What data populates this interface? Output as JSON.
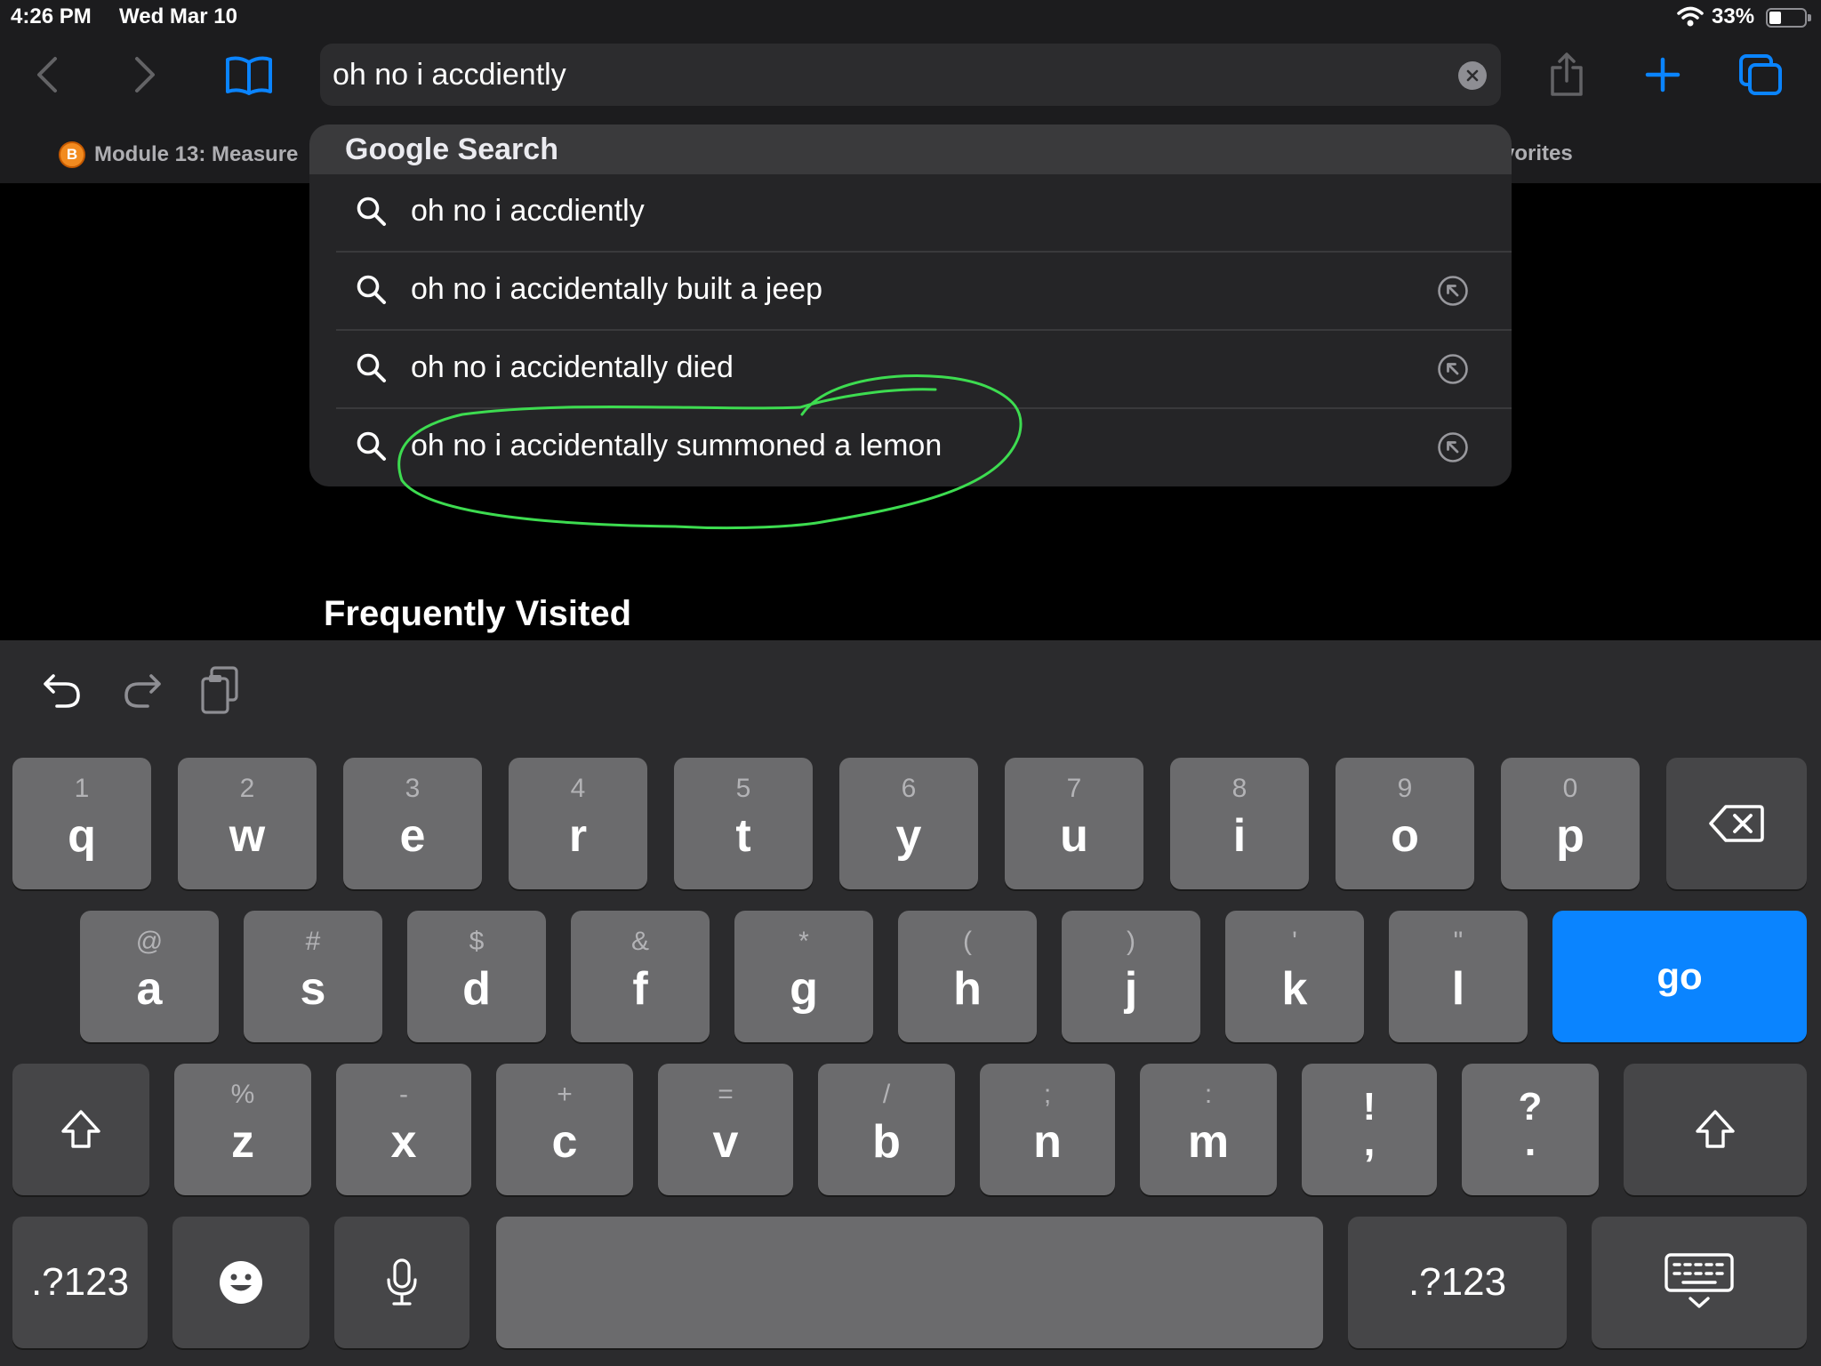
{
  "status_bar": {
    "time": "4:26 PM",
    "date": "Wed Mar 10",
    "battery_percent": "33%",
    "battery_level": 0.33
  },
  "toolbar": {
    "url_text": "oh no i accdiently"
  },
  "favorites_bar": {
    "item": "Module 13: Measure",
    "item_icon_letter": "B",
    "right_text": "vorites"
  },
  "suggestions": {
    "header": "Google Search",
    "items": [
      {
        "text": "oh no i accdiently",
        "has_fill": false
      },
      {
        "text": "oh no i accidentally built a jeep",
        "has_fill": true
      },
      {
        "text": "oh no i accidentally died",
        "has_fill": true
      },
      {
        "text": "oh no i accidentally summoned a lemon",
        "has_fill": true
      }
    ]
  },
  "content": {
    "frequently_visited": "Frequently Visited"
  },
  "colors": {
    "accent": "#0a84ff",
    "annotation": "#3ddc50",
    "keyboard_bg": "#2b2b2d",
    "key_bg": "#6b6b6d"
  },
  "keyboard": {
    "row1": [
      {
        "pri": "q",
        "sec": "1"
      },
      {
        "pri": "w",
        "sec": "2"
      },
      {
        "pri": "e",
        "sec": "3"
      },
      {
        "pri": "r",
        "sec": "4"
      },
      {
        "pri": "t",
        "sec": "5"
      },
      {
        "pri": "y",
        "sec": "6"
      },
      {
        "pri": "u",
        "sec": "7"
      },
      {
        "pri": "i",
        "sec": "8"
      },
      {
        "pri": "o",
        "sec": "9"
      },
      {
        "pri": "p",
        "sec": "0"
      }
    ],
    "row2": [
      {
        "pri": "a",
        "sec": "@"
      },
      {
        "pri": "s",
        "sec": "#"
      },
      {
        "pri": "d",
        "sec": "$"
      },
      {
        "pri": "f",
        "sec": "&"
      },
      {
        "pri": "g",
        "sec": "*"
      },
      {
        "pri": "h",
        "sec": "("
      },
      {
        "pri": "j",
        "sec": ")"
      },
      {
        "pri": "k",
        "sec": "'"
      },
      {
        "pri": "l",
        "sec": "\""
      }
    ],
    "row3": [
      {
        "pri": "z",
        "sec": "%"
      },
      {
        "pri": "x",
        "sec": "-"
      },
      {
        "pri": "c",
        "sec": "+"
      },
      {
        "pri": "v",
        "sec": "="
      },
      {
        "pri": "b",
        "sec": "/"
      },
      {
        "pri": "n",
        "sec": ";"
      },
      {
        "pri": "m",
        "sec": ":"
      },
      {
        "pri": ",",
        "sec": "!"
      },
      {
        "pri": ".",
        "sec": "?"
      }
    ],
    "go": "go",
    "numbers_label": ".?123"
  }
}
